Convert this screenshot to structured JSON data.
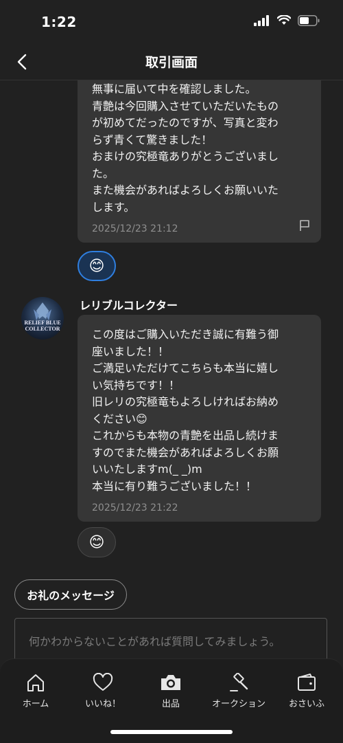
{
  "status_bar": {
    "time": "1:22"
  },
  "header": {
    "title": "取引画面"
  },
  "messages": [
    {
      "text": "無事に届いて中を確認しました。\n青艶は今回購入させていただいたもの\nが初めてだったのですが、写真と変わ\nらず青くて驚きました！\nおまけの究極竜ありがとうございまし\nた。\nまた機会があればよろしくお願いいた\nします。",
      "timestamp": "2025/12/23 21:12",
      "reaction": "😊"
    },
    {
      "sender": "レリブルコレクター",
      "avatar_text": "RELIEF BLUE COLLECTOR",
      "text": "この度はご購入いただき誠に有難う御\n座いました！！\nご満足いただけてこちらも本当に嬉し\nい気持ちです！！\n旧レリの究極竜もよろしければお納め\nください😊\nこれからも本物の青艶を出品し続けま\nすのでまた機会があればよろしくお願\nいいたしますm(_ _)m\n本当に有り難うございました！！",
      "timestamp": "2025/12/23 21:22",
      "reaction": "😊"
    }
  ],
  "thanks_button": {
    "label": "お礼のメッセージ"
  },
  "input": {
    "placeholder": "何かわからないことがあれば質問してみましょう。"
  },
  "tabbar": {
    "items": [
      {
        "label": "ホーム",
        "icon": "home-icon"
      },
      {
        "label": "いいね！",
        "icon": "heart-icon"
      },
      {
        "label": "出品",
        "icon": "camera-icon"
      },
      {
        "label": "オークション",
        "icon": "gavel-icon"
      },
      {
        "label": "おさいふ",
        "icon": "wallet-icon"
      }
    ]
  }
}
